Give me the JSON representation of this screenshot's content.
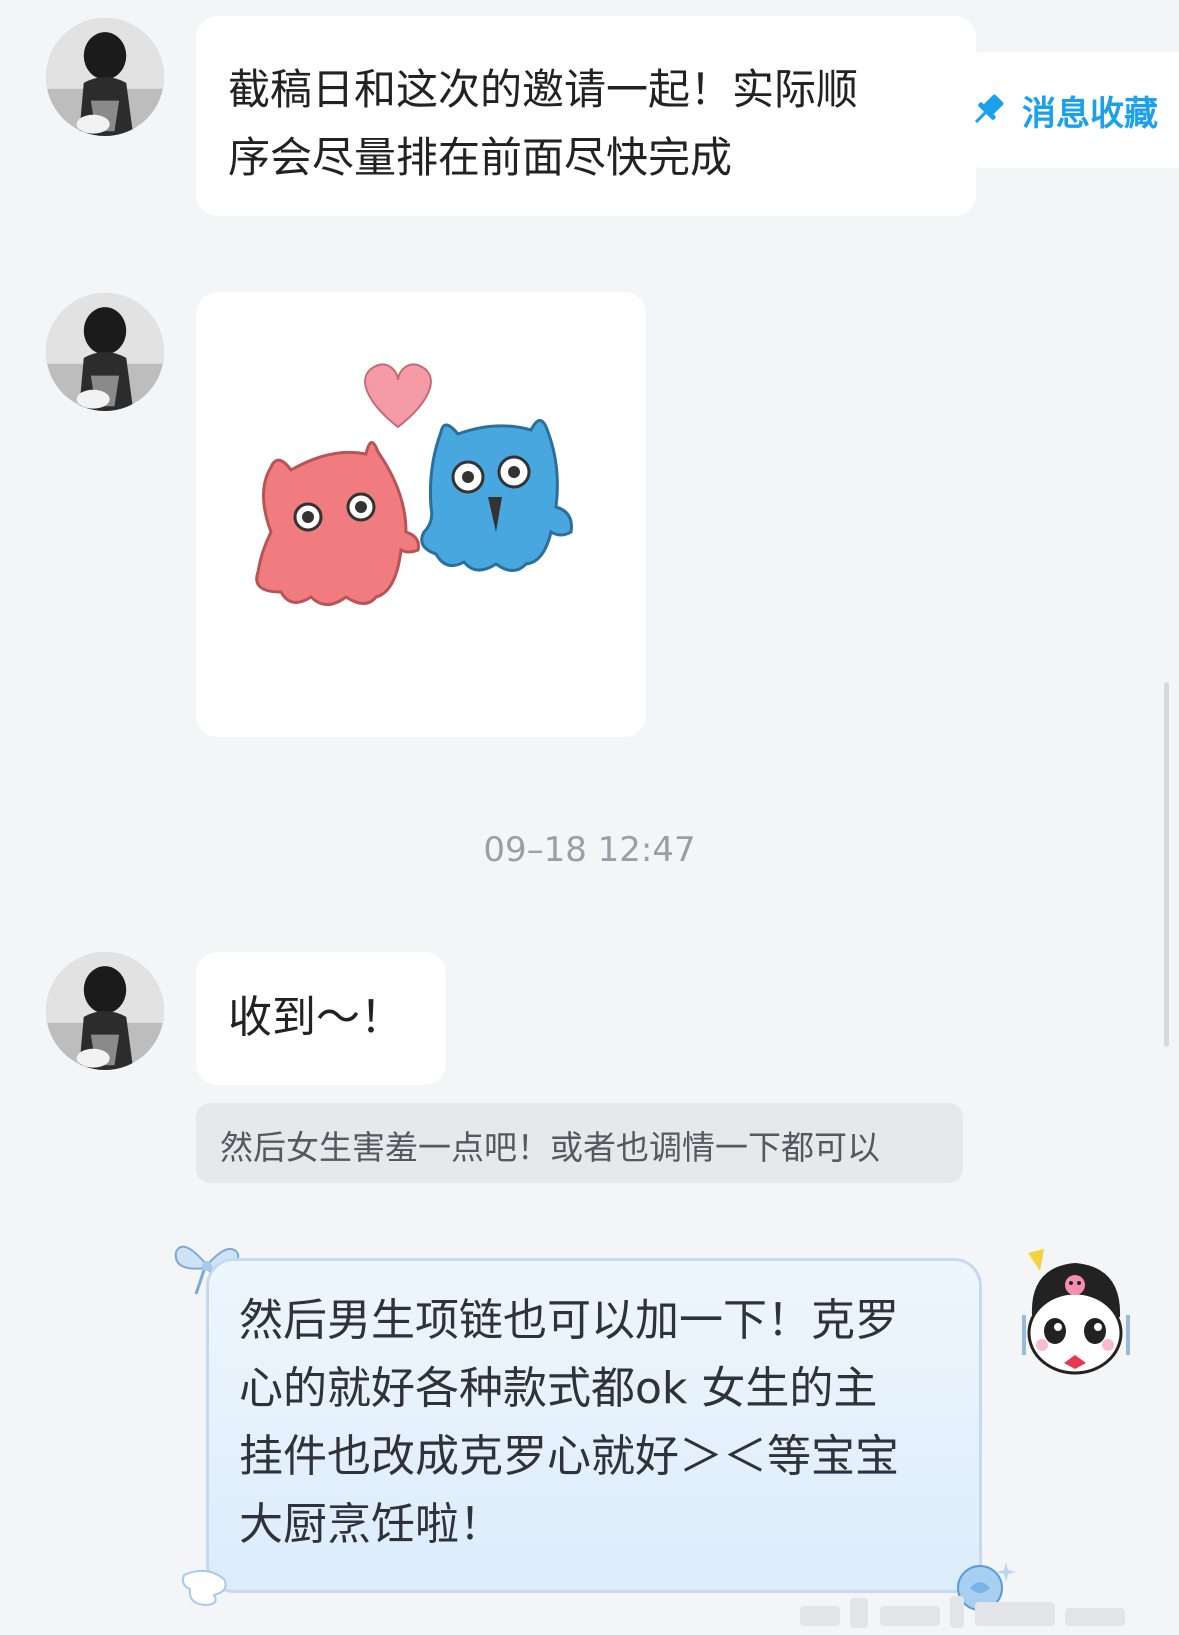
{
  "messages": [
    {
      "type": "text",
      "lines": [
        "截稿日和这次的邀请一起！实际顺",
        "序会尽量排在前面尽快完成"
      ]
    },
    {
      "type": "sticker",
      "sticker": "pink-and-blue-blobs-with-heart"
    },
    {
      "type": "text",
      "text": "收到～！"
    }
  ],
  "favorite": {
    "label": "消息收藏",
    "icon": "pin-icon"
  },
  "timestamp": "09–18 12:47",
  "quote": {
    "text": "然后女生害羞一点吧！或者也调情一下都可以"
  },
  "reply": {
    "lines": [
      "然后男生项链也可以加一下！克罗",
      "心的就好各种款式都ok 女生的主",
      "挂件也改成克罗心就好＞＜等宝宝",
      "大厨烹饪啦！"
    ]
  },
  "colors": {
    "accent": "#1aa0ee",
    "bubble": "#ffffff",
    "reply_bg": "#e4f0fc",
    "background": "#f4f5f7"
  }
}
